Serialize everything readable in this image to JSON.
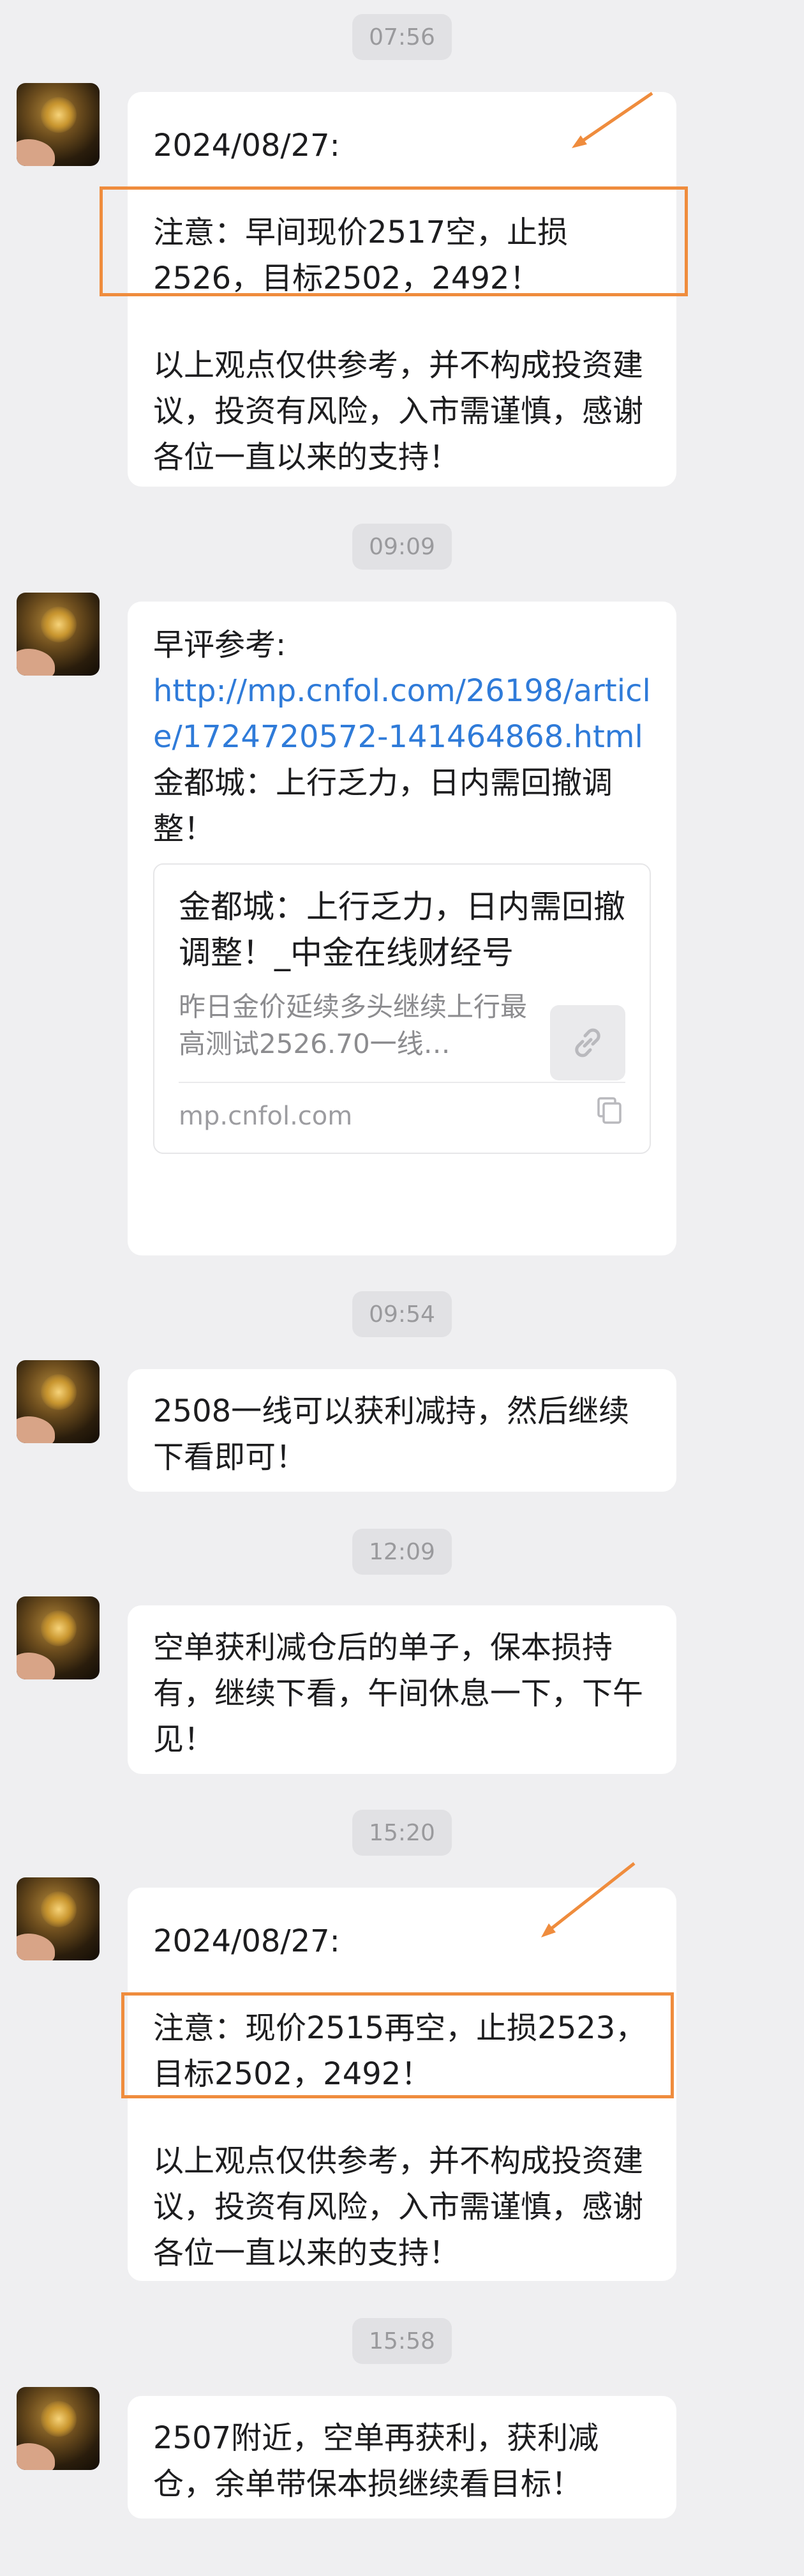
{
  "colors": {
    "background": "#efeff1",
    "bubble": "#ffffff",
    "link": "#2f7bd9",
    "highlight": "#ef8c3d"
  },
  "messages": [
    {
      "time": "07:56",
      "lines": [
        "2024/08/27:",
        "注意：早间现价2517空，止损2526，目标2502，2492！",
        "以上观点仅供参考，并不构成投资建议，投资有风险，入市需谨慎，感谢各位一直以来的支持！"
      ]
    },
    {
      "time": "09:09",
      "intro": "早评参考:",
      "link": "http://mp.cnfol.com/26198/article/1724720572-141464868.html",
      "body": "金都城：上行乏力，日内需回撤调整！",
      "card": {
        "title": "金都城：上行乏力，日内需回撤调整！_中金在线财经号",
        "desc": "昨日金价延续多头继续上行最高测试2526.70一线…",
        "site": "mp.cnfol.com",
        "thumb_icon": "link-icon",
        "copy_icon": "copy-icon"
      }
    },
    {
      "time": "09:54",
      "text": "2508一线可以获利减持，然后继续下看即可！"
    },
    {
      "time": "12:09",
      "text": "空单获利减仓后的单子，保本损持有，继续下看，午间休息一下，下午见！"
    },
    {
      "time": "15:20",
      "lines": [
        "2024/08/27:",
        "注意：现价2515再空，止损2523，目标2502，2492！",
        "以上观点仅供参考，并不构成投资建议，投资有风险，入市需谨慎，感谢各位一直以来的支持！"
      ]
    },
    {
      "time": "15:58",
      "text": "2507附近，空单再获利，获利减仓，余单带保本损继续看目标！"
    }
  ]
}
